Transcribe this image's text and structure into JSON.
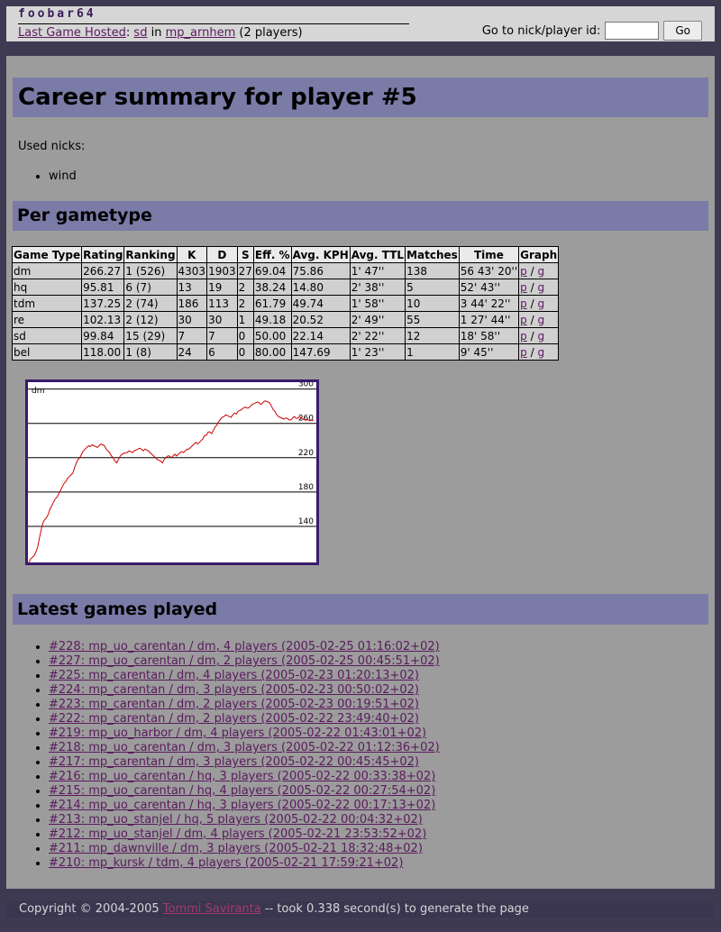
{
  "header": {
    "logo": "foobar64",
    "last_game_label": "Last Game Hosted",
    "last_game_gametype": "sd",
    "last_game_in": "in",
    "last_game_map": "mp_arnhem",
    "last_game_players": "(2 players)",
    "goto_label": "Go to nick/player id:",
    "goto_value": "",
    "goto_button": "Go"
  },
  "career_title": "Career summary for player #5",
  "used_nicks_label": "Used nicks:",
  "nicks": [
    "wind"
  ],
  "per_gametype_title": "Per gametype",
  "table": {
    "headers": [
      "Game Type",
      "Rating",
      "Ranking",
      "K",
      "D",
      "S",
      "Eff. %",
      "Avg. KPH",
      "Avg. TTL",
      "Matches",
      "Time",
      "Graph"
    ],
    "rows": [
      [
        "dm",
        "266.27",
        "1 (526)",
        "4303",
        "1903",
        "27",
        "69.04",
        "75.86",
        "1' 47''",
        "138",
        "56 43' 20''"
      ],
      [
        "hq",
        "95.81",
        "6 (7)",
        "13",
        "19",
        "2",
        "38.24",
        "14.80",
        "2' 38''",
        "5",
        "52' 43''"
      ],
      [
        "tdm",
        "137.25",
        "2 (74)",
        "186",
        "113",
        "2",
        "61.79",
        "49.74",
        "1' 58''",
        "10",
        "3 44' 22''"
      ],
      [
        "re",
        "102.13",
        "2 (12)",
        "30",
        "30",
        "1",
        "49.18",
        "20.52",
        "2' 49''",
        "55",
        "1 27' 44''"
      ],
      [
        "sd",
        "99.84",
        "15 (29)",
        "7",
        "7",
        "0",
        "50.00",
        "22.14",
        "2' 22''",
        "12",
        "18' 58''"
      ],
      [
        "bel",
        "118.00",
        "1 (8)",
        "24",
        "6",
        "0",
        "80.00",
        "147.69",
        "1' 23''",
        "1",
        "9' 45''"
      ]
    ],
    "graph_links": [
      "p",
      "g"
    ],
    "graph_sep": "/"
  },
  "chart_data": {
    "type": "line",
    "title": "dm",
    "xlabel": "",
    "ylabel": "",
    "ylim": [
      98,
      308
    ],
    "y_ticks": [
      140,
      180,
      220,
      260,
      300
    ],
    "grid": true,
    "line_color": "#cc0000",
    "series": [
      {
        "values": [
          98,
          102,
          104,
          106,
          110,
          116,
          126,
          136,
          144,
          148,
          150,
          154,
          160,
          164,
          168,
          172,
          174,
          178,
          182,
          186,
          190,
          192,
          196,
          198,
          200,
          202,
          208,
          214,
          218,
          220,
          224,
          228,
          230,
          232,
          234,
          233,
          235,
          234,
          233,
          232,
          234,
          236,
          235,
          234,
          230,
          228,
          226,
          222,
          220,
          216,
          214,
          218,
          222,
          224,
          225,
          226,
          226,
          228,
          227,
          226,
          228,
          229,
          230,
          231,
          230,
          228,
          230,
          229,
          228,
          226,
          224,
          222,
          220,
          218,
          217,
          216,
          214,
          218,
          220,
          222,
          222,
          220,
          222,
          224,
          222,
          224,
          226,
          227,
          226,
          228,
          230,
          230,
          232,
          234,
          236,
          238,
          236,
          238,
          240,
          242,
          246,
          246,
          250,
          250,
          248,
          252,
          256,
          258,
          262,
          265,
          267,
          268,
          270,
          269,
          268,
          267,
          270,
          272,
          271,
          274,
          275,
          276,
          278,
          279,
          278,
          278,
          280,
          282,
          283,
          284,
          285,
          284,
          282,
          284,
          286,
          286,
          285,
          284,
          280,
          276,
          274,
          270,
          268,
          267,
          266,
          265,
          266,
          266,
          264,
          264,
          266,
          268,
          266,
          266,
          268,
          266,
          265,
          264,
          265,
          264,
          263,
          264,
          263
        ]
      }
    ]
  },
  "latest_games_title": "Latest games played",
  "games": [
    "#228: mp_uo_carentan / dm, 4 players (2005-02-25 01:16:02+02)",
    "#227: mp_uo_carentan / dm, 2 players (2005-02-25 00:45:51+02)",
    "#225: mp_carentan / dm, 4 players (2005-02-23 01:20:13+02)",
    "#224: mp_carentan / dm, 3 players (2005-02-23 00:50:02+02)",
    "#223: mp_carentan / dm, 2 players (2005-02-23 00:19:51+02)",
    "#222: mp_carentan / dm, 2 players (2005-02-22 23:49:40+02)",
    "#219: mp_uo_harbor / dm, 4 players (2005-02-22 01:43:01+02)",
    "#218: mp_uo_carentan / dm, 3 players (2005-02-22 01:12:36+02)",
    "#217: mp_carentan / dm, 3 players (2005-02-22 00:45:45+02)",
    "#216: mp_uo_carentan / hq, 3 players (2005-02-22 00:33:38+02)",
    "#215: mp_uo_carentan / hq, 4 players (2005-02-22 00:27:54+02)",
    "#214: mp_uo_carentan / hq, 3 players (2005-02-22 00:17:13+02)",
    "#213: mp_uo_stanjel / hq, 5 players (2005-02-22 00:04:32+02)",
    "#212: mp_uo_stanjel / dm, 4 players (2005-02-21 23:53:52+02)",
    "#211: mp_dawnville / dm, 3 players (2005-02-21 18:32:48+02)",
    "#210: mp_kursk / tdm, 4 players (2005-02-21 17:59:21+02)"
  ],
  "footer": {
    "copyright": "Copyright © 2004-2005",
    "author": "Tommi Saviranta",
    "timing": "-- took 0.338 second(s) to generate the page"
  }
}
